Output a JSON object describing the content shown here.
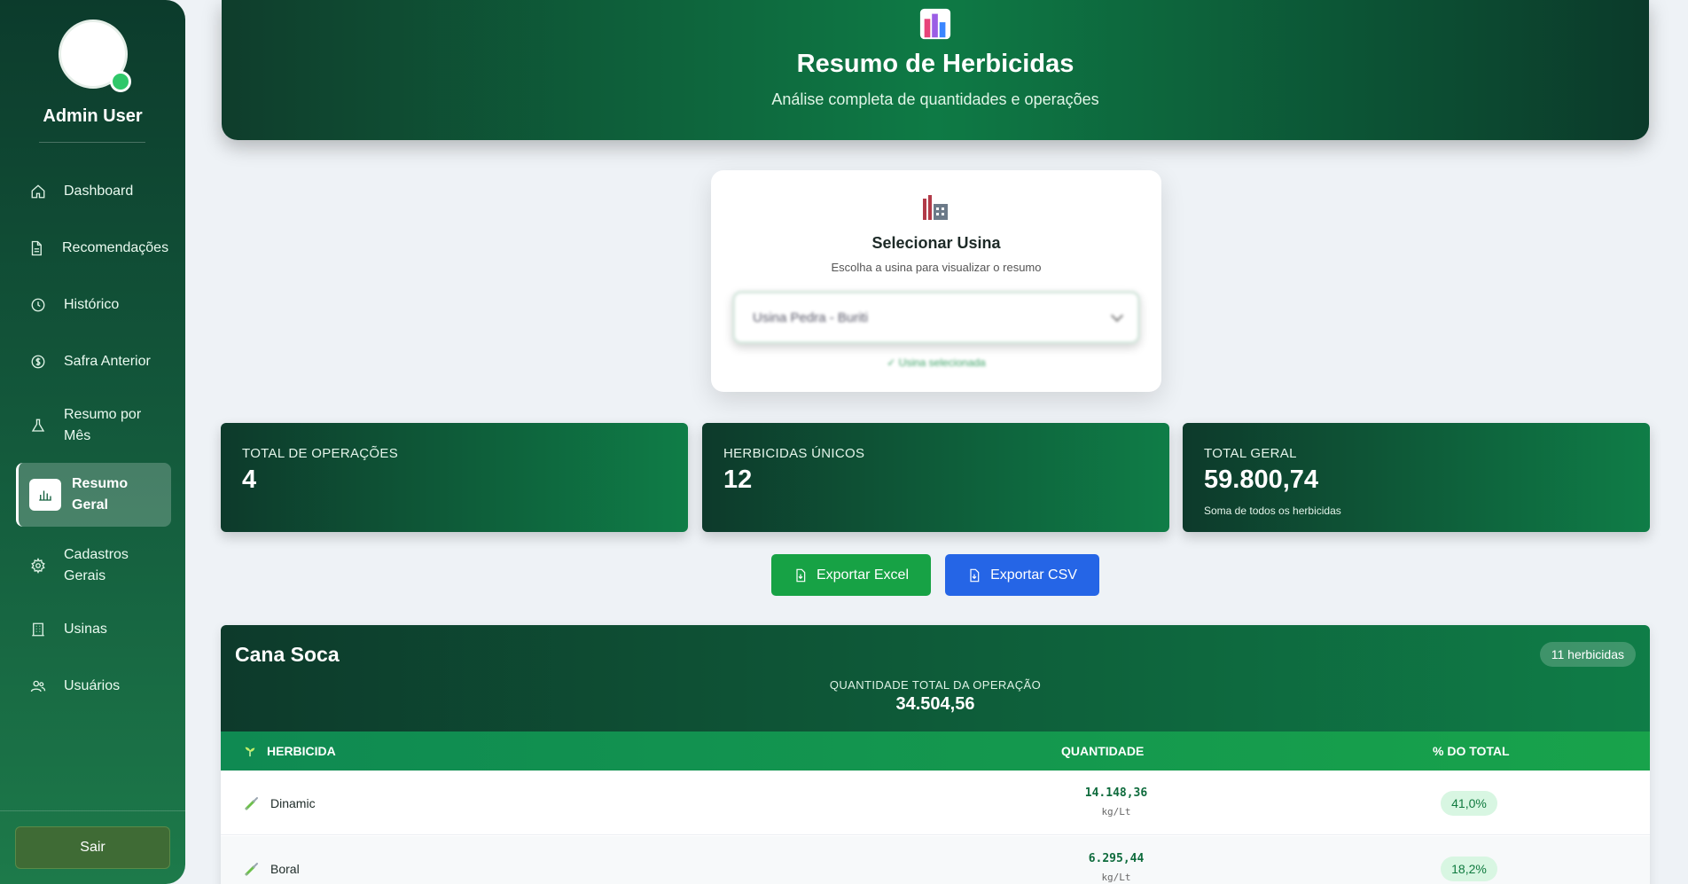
{
  "sidebar": {
    "user_name": "Admin User",
    "items": [
      {
        "label": "Dashboard",
        "icon": "home-icon"
      },
      {
        "label": "Recomendações",
        "icon": "document-icon"
      },
      {
        "label": "Histórico",
        "icon": "clock-icon"
      },
      {
        "label": "Safra Anterior",
        "icon": "dollar-icon"
      },
      {
        "label": "Resumo por Mês",
        "icon": "flask-icon"
      },
      {
        "label": "Resumo Geral",
        "icon": "bar-chart-icon",
        "active": true
      },
      {
        "label": "Cadastros Gerais",
        "icon": "gear-icon"
      },
      {
        "label": "Usinas",
        "icon": "building-icon"
      },
      {
        "label": "Usuários",
        "icon": "users-icon"
      }
    ],
    "logout_label": "Sair"
  },
  "header": {
    "title": "Resumo de Herbicidas",
    "subtitle": "Análise completa de quantidades e operações"
  },
  "usina": {
    "title": "Selecionar Usina",
    "subtitle": "Escolha a usina para visualizar o resumo",
    "selected": "Usina Pedra - Buriti",
    "status": "✓ Usina selecionada"
  },
  "stats": [
    {
      "label": "TOTAL DE OPERAÇÕES",
      "value": "4",
      "note": ""
    },
    {
      "label": "HERBICIDAS ÚNICOS",
      "value": "12",
      "note": ""
    },
    {
      "label": "TOTAL GERAL",
      "value": "59.800,74",
      "note": "Soma de todos os herbicidas"
    }
  ],
  "actions": {
    "excel_label": "Exportar Excel",
    "csv_label": "Exportar CSV"
  },
  "operation": {
    "title": "Cana Soca",
    "badge": "11 herbicidas",
    "total_label": "QUANTIDADE TOTAL DA OPERAÇÃO",
    "total_value": "34.504,56",
    "columns": {
      "herbicide": "HERBICIDA",
      "quantity": "QUANTIDADE",
      "percent": "% DO TOTAL"
    },
    "rows": [
      {
        "name": "Dinamic",
        "quantity": "14.148,36",
        "unit": "kg/Lt",
        "percent": "41,0%"
      },
      {
        "name": "Boral",
        "quantity": "6.295,44",
        "unit": "kg/Lt",
        "percent": "18,2%"
      }
    ]
  },
  "colors": {
    "primary_green": "#0f7d47",
    "dark_green": "#0d3a2b",
    "excel_green": "#17a245",
    "csv_blue": "#2565e6",
    "online_dot": "#2fc769"
  }
}
